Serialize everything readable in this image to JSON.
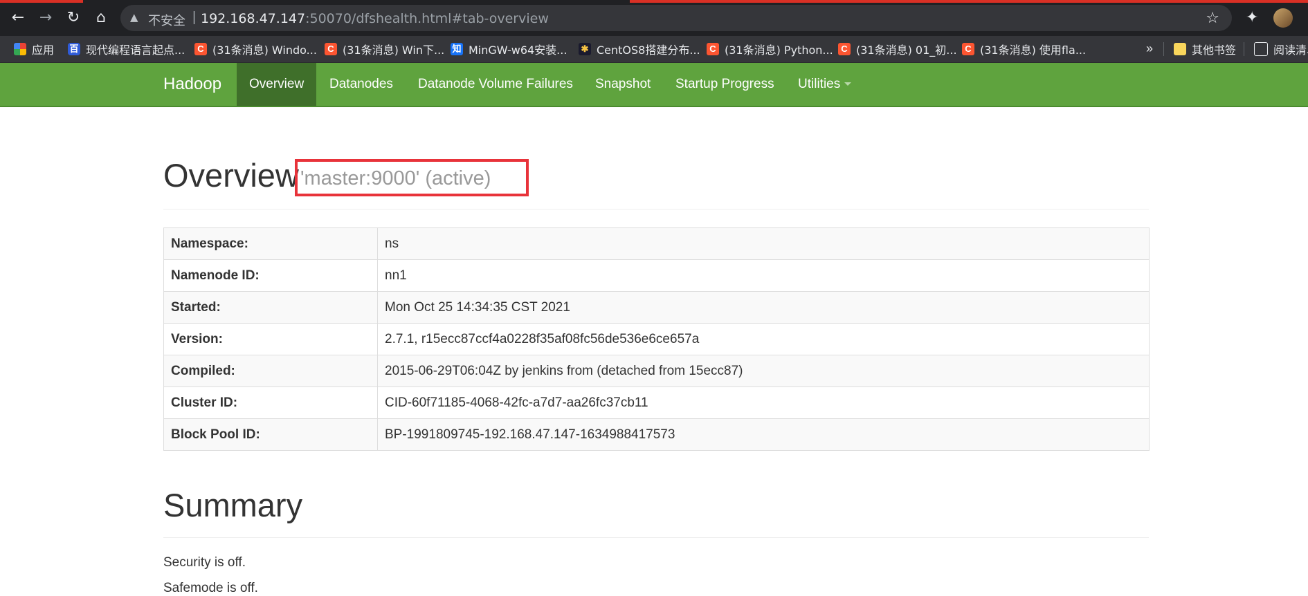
{
  "browser": {
    "insecure_label": "不安全",
    "separator": "|",
    "url_host": "192.168.47.147",
    "url_rest": ":50070/dfshealth.html#tab-overview",
    "icons": [
      "back-icon",
      "forward-icon",
      "reload-icon",
      "home-icon",
      "warning-icon",
      "star-icon",
      "extensions-icon"
    ]
  },
  "bookmarks": {
    "items": [
      {
        "label": "应用",
        "icon": "apps-icon"
      },
      {
        "label": "现代编程语言起点...",
        "icon": "baidu-icon"
      },
      {
        "label": "(31条消息) Windo...",
        "icon": "csdn-icon"
      },
      {
        "label": "(31条消息) Win下...",
        "icon": "csdn-icon"
      },
      {
        "label": "MinGW-w64安装...",
        "icon": "zhihu-icon"
      },
      {
        "label": "CentOS8搭建分布...",
        "icon": "centos-icon"
      },
      {
        "label": "(31条消息) Python...",
        "icon": "csdn-icon"
      },
      {
        "label": "(31条消息) 01_初...",
        "icon": "csdn-icon"
      },
      {
        "label": "(31条消息) 使用fla...",
        "icon": "csdn-icon"
      }
    ],
    "more": "»",
    "other_bookmarks": "其他书签",
    "reading_list": "阅读清单"
  },
  "navbar": {
    "brand": "Hadoop",
    "items": [
      "Overview",
      "Datanodes",
      "Datanode Volume Failures",
      "Snapshot",
      "Startup Progress",
      "Utilities"
    ],
    "active": "Overview"
  },
  "overview": {
    "title": "Overview",
    "subtitle": "'master:9000' (active)",
    "rows": [
      {
        "key": "Namespace:",
        "value": "ns"
      },
      {
        "key": "Namenode ID:",
        "value": "nn1"
      },
      {
        "key": "Started:",
        "value": "Mon Oct 25 14:34:35 CST 2021"
      },
      {
        "key": "Version:",
        "value": "2.7.1, r15ecc87ccf4a0228f35af08fc56de536e6ce657a"
      },
      {
        "key": "Compiled:",
        "value": "2015-06-29T06:04Z by jenkins from (detached from 15ecc87)"
      },
      {
        "key": "Cluster ID:",
        "value": "CID-60f71185-4068-42fc-a7d7-aa26fc37cb11"
      },
      {
        "key": "Block Pool ID:",
        "value": "BP-1991809745-192.168.47.147-1634988417573"
      }
    ]
  },
  "summary": {
    "title": "Summary",
    "security": "Security is off.",
    "safemode": "Safemode is off."
  },
  "colors": {
    "navbar": "#5fa33e",
    "navbar_active": "#3f6f2a",
    "highlight": "#e8333a"
  }
}
